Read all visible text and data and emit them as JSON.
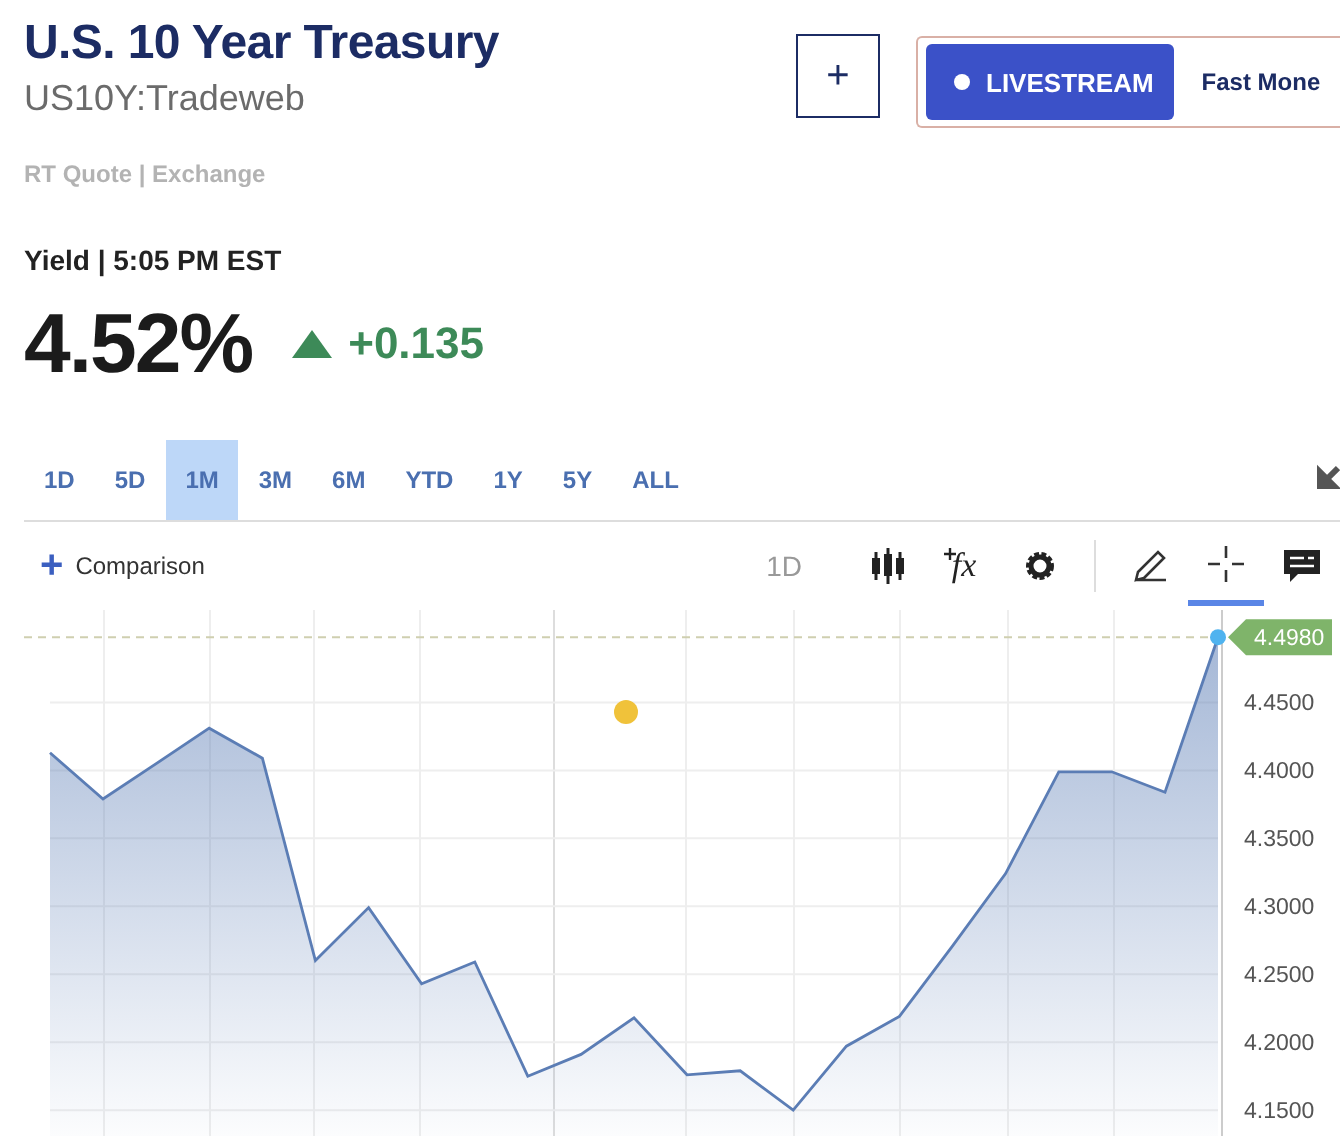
{
  "quote": {
    "title": "U.S. 10 Year Treasury",
    "symbol": "US10Y:Tradeweb",
    "source": "RT Quote | Exchange"
  },
  "actions": {
    "add_button": "+",
    "livestream_button": "LIVESTREAM",
    "show_name": "Fast Mone"
  },
  "price": {
    "label": "Yield | 5:05 PM EST",
    "value": "4.52%",
    "rising": true,
    "change": "+0.135"
  },
  "ranges": [
    {
      "label": "1D",
      "selected": false
    },
    {
      "label": "5D",
      "selected": false
    },
    {
      "label": "1M",
      "selected": true
    },
    {
      "label": "3M",
      "selected": false
    },
    {
      "label": "6M",
      "selected": false
    },
    {
      "label": "YTD",
      "selected": false
    },
    {
      "label": "1Y",
      "selected": false
    },
    {
      "label": "5Y",
      "selected": false
    },
    {
      "label": "ALL",
      "selected": false
    }
  ],
  "toolbar": {
    "comparison_icon": "+",
    "comparison": "Comparison",
    "interval": "1D",
    "tools": [
      {
        "kind": "candles",
        "selected": false
      },
      {
        "kind": "fx",
        "label": "fx",
        "selected": false
      },
      {
        "kind": "gear",
        "selected": false
      },
      {
        "kind": "pencil",
        "selected": false
      },
      {
        "kind": "crosshair",
        "selected": true
      },
      {
        "kind": "comment",
        "selected": false
      }
    ]
  },
  "chart": {
    "last_value": "4.4980",
    "chart_data": {
      "type": "area",
      "grid": true,
      "ylim": [
        4.131,
        4.518
      ],
      "ref_lines": [
        {
          "axis": "y",
          "value": 4.498
        }
      ],
      "series": [
        {
          "color": "#5b7db5",
          "values": [
            4.413,
            4.379,
            4.405,
            4.431,
            4.409,
            4.26,
            4.299,
            4.243,
            4.259,
            4.175,
            4.191,
            4.218,
            4.176,
            4.179,
            4.15,
            4.197,
            4.219,
            4.271,
            4.324,
            4.399,
            4.399,
            4.384,
            4.498
          ]
        }
      ],
      "yticks": [
        {
          "value": 4.15,
          "label": "4.1500"
        },
        {
          "value": 4.2,
          "label": "4.2000"
        },
        {
          "value": 4.25,
          "label": "4.2500"
        },
        {
          "value": 4.3,
          "label": "4.3000"
        },
        {
          "value": 4.35,
          "label": "4.3500"
        },
        {
          "value": 4.4,
          "label": "4.4000"
        },
        {
          "value": 4.45,
          "label": "4.4500"
        }
      ]
    }
  }
}
